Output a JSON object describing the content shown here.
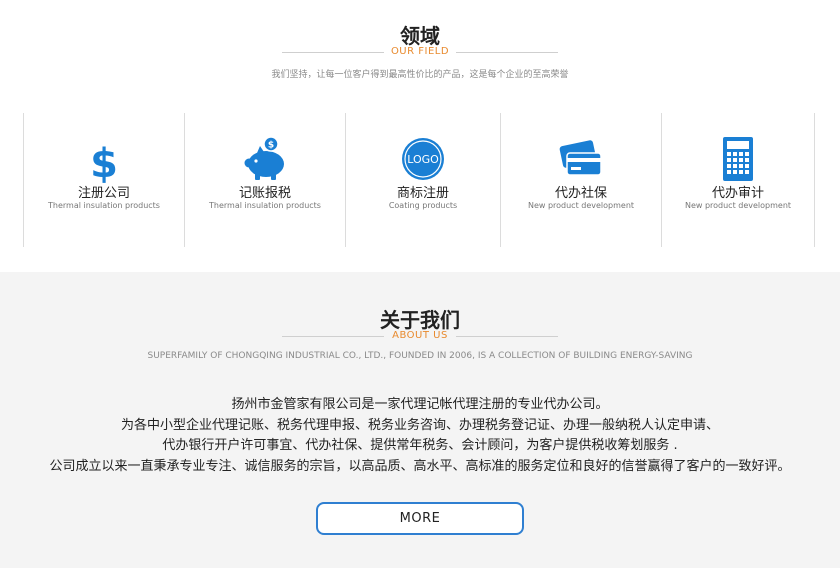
{
  "field": {
    "title": "领域",
    "subtitle": "OUR FIELD",
    "description": "我们坚持，让每一位客户得到最高性价比的产品，这是每个企业的至高荣誉",
    "cards": [
      {
        "icon": "dollar-icon",
        "name": "注册公司",
        "en": "Thermal insulation products"
      },
      {
        "icon": "piggy-bank-icon",
        "name": "记账报税",
        "en": "Thermal insulation products"
      },
      {
        "icon": "logo-badge-icon",
        "icon_text": "LOGO",
        "name": "商标注册",
        "en": "Coating products"
      },
      {
        "icon": "credit-card-icon",
        "name": "代办社保",
        "en": "New product development"
      },
      {
        "icon": "calculator-icon",
        "name": "代办审计",
        "en": "New product development"
      }
    ]
  },
  "about": {
    "title": "关于我们",
    "subtitle": "ABOUT US",
    "description": "SUPERFAMILY OF CHONGQING INDUSTRIAL CO., LTD., FOUNDED IN 2006, IS A COLLECTION OF BUILDING ENERGY-SAVING",
    "lines": [
      "扬州市金管家有限公司是一家代理记帐代理注册的专业代办公司。",
      "为各中小型企业代理记账、税务代理申报、税务业务咨询、办理税务登记证、办理一般纳税人认定申请、",
      "代办银行开户许可事宜、代办社保、提供常年税务、会计顾问，为客户提供税收筹划服务 .",
      "公司成立以来一直秉承专业专注、诚信服务的宗旨，以高品质、高水平、高标准的服务定位和良好的信誉赢得了客户的一致好评。"
    ],
    "more_label": "MORE"
  },
  "colors": {
    "accent_orange": "#e88a2e",
    "icon_blue": "#1a7fd4",
    "button_border": "#2f7fd1",
    "about_bg": "#f4f4f4"
  }
}
